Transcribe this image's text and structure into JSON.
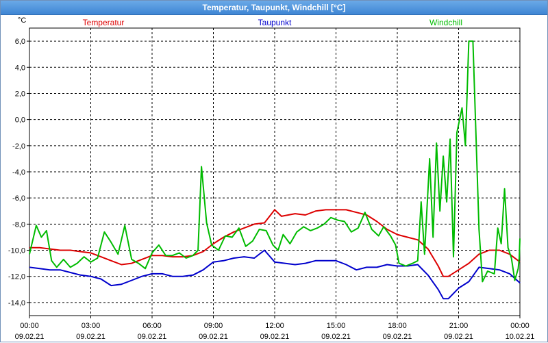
{
  "window": {
    "title": "Temperatur, Taupunkt, Windchill [°C]"
  },
  "chart_data": {
    "type": "line",
    "title": "Temperatur, Taupunkt, Windchill [°C]",
    "ylabel": "°C",
    "xlabel": "",
    "ylim": [
      -15,
      7
    ],
    "xlim": [
      "2021-02-09 00:00",
      "2021-02-10 00:00"
    ],
    "grid": true,
    "legend_placement": "top",
    "y_ticks": [
      "6,0",
      "4,0",
      "2,0",
      "0,0",
      "-2,0",
      "-4,0",
      "-6,0",
      "-8,0",
      "-10,0",
      "-12,0",
      "-14,0"
    ],
    "x_ticks": [
      {
        "time": "00:00",
        "date": "09.02.21"
      },
      {
        "time": "03:00",
        "date": "09.02.21"
      },
      {
        "time": "06:00",
        "date": "09.02.21"
      },
      {
        "time": "09:00",
        "date": "09.02.21"
      },
      {
        "time": "12:00",
        "date": "09.02.21"
      },
      {
        "time": "15:00",
        "date": "09.02.21"
      },
      {
        "time": "18:00",
        "date": "09.02.21"
      },
      {
        "time": "21:00",
        "date": "09.02.21"
      },
      {
        "time": "00:00",
        "date": "10.02.21"
      }
    ],
    "series": [
      {
        "name": "Temperatur",
        "color": "#dd0000",
        "points": [
          [
            "2021-02-09 00:00",
            -9.8
          ],
          [
            "2021-02-09 00:30",
            -9.8
          ],
          [
            "2021-02-09 01:00",
            -9.9
          ],
          [
            "2021-02-09 01:30",
            -10.0
          ],
          [
            "2021-02-09 02:00",
            -10.0
          ],
          [
            "2021-02-09 02:30",
            -10.1
          ],
          [
            "2021-02-09 03:00",
            -10.2
          ],
          [
            "2021-02-09 03:30",
            -10.5
          ],
          [
            "2021-02-09 04:00",
            -10.8
          ],
          [
            "2021-02-09 04:30",
            -11.1
          ],
          [
            "2021-02-09 05:00",
            -11.0
          ],
          [
            "2021-02-09 05:30",
            -10.7
          ],
          [
            "2021-02-09 06:00",
            -10.4
          ],
          [
            "2021-02-09 06:30",
            -10.4
          ],
          [
            "2021-02-09 07:00",
            -10.5
          ],
          [
            "2021-02-09 07:30",
            -10.5
          ],
          [
            "2021-02-09 08:00",
            -10.4
          ],
          [
            "2021-02-09 08:30",
            -10.1
          ],
          [
            "2021-02-09 09:00",
            -9.5
          ],
          [
            "2021-02-09 09:30",
            -9.0
          ],
          [
            "2021-02-09 10:00",
            -8.6
          ],
          [
            "2021-02-09 10:30",
            -8.3
          ],
          [
            "2021-02-09 11:00",
            -8.0
          ],
          [
            "2021-02-09 11:30",
            -7.9
          ],
          [
            "2021-02-09 12:00",
            -6.9
          ],
          [
            "2021-02-09 12:20",
            -7.4
          ],
          [
            "2021-02-09 13:00",
            -7.2
          ],
          [
            "2021-02-09 13:30",
            -7.3
          ],
          [
            "2021-02-09 14:00",
            -7.0
          ],
          [
            "2021-02-09 14:30",
            -6.9
          ],
          [
            "2021-02-09 15:00",
            -6.9
          ],
          [
            "2021-02-09 15:30",
            -6.9
          ],
          [
            "2021-02-09 16:00",
            -7.1
          ],
          [
            "2021-02-09 16:30",
            -7.3
          ],
          [
            "2021-02-09 17:00",
            -7.8
          ],
          [
            "2021-02-09 17:30",
            -8.4
          ],
          [
            "2021-02-09 18:00",
            -8.8
          ],
          [
            "2021-02-09 18:30",
            -9.0
          ],
          [
            "2021-02-09 19:00",
            -9.2
          ],
          [
            "2021-02-09 19:30",
            -9.9
          ],
          [
            "2021-02-09 20:00",
            -11.2
          ],
          [
            "2021-02-09 20:15",
            -12.0
          ],
          [
            "2021-02-09 20:30",
            -12.0
          ],
          [
            "2021-02-09 21:00",
            -11.5
          ],
          [
            "2021-02-09 21:30",
            -11.0
          ],
          [
            "2021-02-09 22:00",
            -10.3
          ],
          [
            "2021-02-09 22:30",
            -10.0
          ],
          [
            "2021-02-09 23:00",
            -10.0
          ],
          [
            "2021-02-09 23:30",
            -10.3
          ],
          [
            "2021-02-10 00:00",
            -10.9
          ]
        ]
      },
      {
        "name": "Taupunkt",
        "color": "#0000cc",
        "points": [
          [
            "2021-02-09 00:00",
            -11.3
          ],
          [
            "2021-02-09 00:30",
            -11.4
          ],
          [
            "2021-02-09 01:00",
            -11.5
          ],
          [
            "2021-02-09 01:30",
            -11.5
          ],
          [
            "2021-02-09 02:00",
            -11.7
          ],
          [
            "2021-02-09 02:30",
            -11.9
          ],
          [
            "2021-02-09 03:00",
            -12.0
          ],
          [
            "2021-02-09 03:30",
            -12.2
          ],
          [
            "2021-02-09 04:00",
            -12.7
          ],
          [
            "2021-02-09 04:30",
            -12.6
          ],
          [
            "2021-02-09 05:00",
            -12.3
          ],
          [
            "2021-02-09 05:30",
            -12.0
          ],
          [
            "2021-02-09 06:00",
            -11.8
          ],
          [
            "2021-02-09 06:30",
            -11.8
          ],
          [
            "2021-02-09 07:00",
            -12.0
          ],
          [
            "2021-02-09 07:30",
            -12.0
          ],
          [
            "2021-02-09 08:00",
            -11.9
          ],
          [
            "2021-02-09 08:30",
            -11.5
          ],
          [
            "2021-02-09 09:00",
            -10.9
          ],
          [
            "2021-02-09 09:30",
            -10.8
          ],
          [
            "2021-02-09 10:00",
            -10.6
          ],
          [
            "2021-02-09 10:30",
            -10.5
          ],
          [
            "2021-02-09 11:00",
            -10.6
          ],
          [
            "2021-02-09 11:30",
            -10.0
          ],
          [
            "2021-02-09 12:00",
            -10.9
          ],
          [
            "2021-02-09 12:30",
            -11.0
          ],
          [
            "2021-02-09 13:00",
            -11.1
          ],
          [
            "2021-02-09 13:30",
            -11.0
          ],
          [
            "2021-02-09 14:00",
            -10.8
          ],
          [
            "2021-02-09 14:30",
            -10.8
          ],
          [
            "2021-02-09 15:00",
            -10.8
          ],
          [
            "2021-02-09 15:30",
            -11.1
          ],
          [
            "2021-02-09 16:00",
            -11.5
          ],
          [
            "2021-02-09 16:30",
            -11.3
          ],
          [
            "2021-02-09 17:00",
            -11.3
          ],
          [
            "2021-02-09 17:30",
            -11.1
          ],
          [
            "2021-02-09 18:00",
            -11.2
          ],
          [
            "2021-02-09 18:30",
            -11.2
          ],
          [
            "2021-02-09 19:00",
            -11.1
          ],
          [
            "2021-02-09 19:30",
            -11.9
          ],
          [
            "2021-02-09 20:00",
            -13.0
          ],
          [
            "2021-02-09 20:15",
            -13.7
          ],
          [
            "2021-02-09 20:30",
            -13.7
          ],
          [
            "2021-02-09 21:00",
            -12.9
          ],
          [
            "2021-02-09 21:30",
            -12.4
          ],
          [
            "2021-02-09 22:00",
            -11.3
          ],
          [
            "2021-02-09 22:30",
            -11.4
          ],
          [
            "2021-02-09 23:00",
            -11.5
          ],
          [
            "2021-02-09 23:30",
            -11.8
          ],
          [
            "2021-02-10 00:00",
            -12.5
          ]
        ]
      },
      {
        "name": "Windchill",
        "color": "#00bb00",
        "points": [
          [
            "2021-02-09 00:00",
            -10.3
          ],
          [
            "2021-02-09 00:20",
            -8.1
          ],
          [
            "2021-02-09 00:35",
            -9.0
          ],
          [
            "2021-02-09 00:50",
            -8.5
          ],
          [
            "2021-02-09 01:05",
            -10.8
          ],
          [
            "2021-02-09 01:20",
            -11.3
          ],
          [
            "2021-02-09 01:40",
            -10.7
          ],
          [
            "2021-02-09 02:00",
            -11.3
          ],
          [
            "2021-02-09 02:20",
            -11.0
          ],
          [
            "2021-02-09 02:40",
            -10.5
          ],
          [
            "2021-02-09 03:00",
            -10.9
          ],
          [
            "2021-02-09 03:20",
            -10.6
          ],
          [
            "2021-02-09 03:40",
            -8.6
          ],
          [
            "2021-02-09 04:00",
            -9.4
          ],
          [
            "2021-02-09 04:20",
            -10.3
          ],
          [
            "2021-02-09 04:40",
            -8.1
          ],
          [
            "2021-02-09 05:00",
            -10.7
          ],
          [
            "2021-02-09 05:20",
            -11.0
          ],
          [
            "2021-02-09 05:40",
            -11.4
          ],
          [
            "2021-02-09 06:00",
            -10.2
          ],
          [
            "2021-02-09 06:20",
            -9.6
          ],
          [
            "2021-02-09 06:40",
            -10.4
          ],
          [
            "2021-02-09 07:00",
            -10.4
          ],
          [
            "2021-02-09 07:20",
            -10.2
          ],
          [
            "2021-02-09 07:40",
            -10.6
          ],
          [
            "2021-02-09 08:00",
            -10.4
          ],
          [
            "2021-02-09 08:15",
            -10.0
          ],
          [
            "2021-02-09 08:25",
            -3.6
          ],
          [
            "2021-02-09 08:40",
            -7.9
          ],
          [
            "2021-02-09 08:55",
            -9.6
          ],
          [
            "2021-02-09 09:15",
            -10.0
          ],
          [
            "2021-02-09 09:35",
            -8.9
          ],
          [
            "2021-02-09 09:55",
            -9.0
          ],
          [
            "2021-02-09 10:15",
            -8.3
          ],
          [
            "2021-02-09 10:35",
            -9.7
          ],
          [
            "2021-02-09 10:55",
            -9.3
          ],
          [
            "2021-02-09 11:15",
            -8.4
          ],
          [
            "2021-02-09 11:35",
            -8.5
          ],
          [
            "2021-02-09 11:55",
            -9.6
          ],
          [
            "2021-02-09 12:10",
            -10.0
          ],
          [
            "2021-02-09 12:25",
            -8.8
          ],
          [
            "2021-02-09 12:45",
            -9.5
          ],
          [
            "2021-02-09 13:05",
            -8.6
          ],
          [
            "2021-02-09 13:25",
            -8.2
          ],
          [
            "2021-02-09 13:45",
            -8.5
          ],
          [
            "2021-02-09 14:05",
            -8.3
          ],
          [
            "2021-02-09 14:25",
            -8.0
          ],
          [
            "2021-02-09 14:45",
            -7.5
          ],
          [
            "2021-02-09 15:05",
            -7.7
          ],
          [
            "2021-02-09 15:25",
            -7.8
          ],
          [
            "2021-02-09 15:45",
            -8.6
          ],
          [
            "2021-02-09 16:05",
            -8.3
          ],
          [
            "2021-02-09 16:25",
            -7.1
          ],
          [
            "2021-02-09 16:45",
            -8.4
          ],
          [
            "2021-02-09 17:05",
            -8.9
          ],
          [
            "2021-02-09 17:20",
            -8.2
          ],
          [
            "2021-02-09 17:40",
            -8.9
          ],
          [
            "2021-02-09 17:55",
            -9.6
          ],
          [
            "2021-02-09 18:05",
            -11.0
          ],
          [
            "2021-02-09 18:25",
            -11.2
          ],
          [
            "2021-02-09 18:45",
            -11.0
          ],
          [
            "2021-02-09 19:00",
            -10.8
          ],
          [
            "2021-02-09 19:10",
            -6.3
          ],
          [
            "2021-02-09 19:20",
            -10.3
          ],
          [
            "2021-02-09 19:35",
            -3.0
          ],
          [
            "2021-02-09 19:45",
            -9.0
          ],
          [
            "2021-02-09 19:55",
            -1.8
          ],
          [
            "2021-02-09 20:05",
            -7.0
          ],
          [
            "2021-02-09 20:15",
            -2.8
          ],
          [
            "2021-02-09 20:25",
            -6.3
          ],
          [
            "2021-02-09 20:35",
            -1.5
          ],
          [
            "2021-02-09 20:45",
            -10.5
          ],
          [
            "2021-02-09 20:55",
            -1.0
          ],
          [
            "2021-02-09 21:10",
            0.9
          ],
          [
            "2021-02-09 21:20",
            -2.0
          ],
          [
            "2021-02-09 21:30",
            6.0
          ],
          [
            "2021-02-09 21:42",
            6.0
          ],
          [
            "2021-02-09 22:00",
            -8.4
          ],
          [
            "2021-02-09 22:10",
            -12.4
          ],
          [
            "2021-02-09 22:25",
            -11.6
          ],
          [
            "2021-02-09 22:45",
            -11.8
          ],
          [
            "2021-02-09 22:55",
            -8.3
          ],
          [
            "2021-02-09 23:05",
            -9.5
          ],
          [
            "2021-02-09 23:15",
            -5.3
          ],
          [
            "2021-02-09 23:25",
            -9.8
          ],
          [
            "2021-02-09 23:35",
            -10.6
          ],
          [
            "2021-02-09 23:45",
            -12.3
          ],
          [
            "2021-02-09 23:55",
            -11.4
          ],
          [
            "2021-02-09 23:58",
            -10.6
          ],
          [
            "2021-02-10 00:00",
            -9.1
          ]
        ]
      }
    ]
  }
}
